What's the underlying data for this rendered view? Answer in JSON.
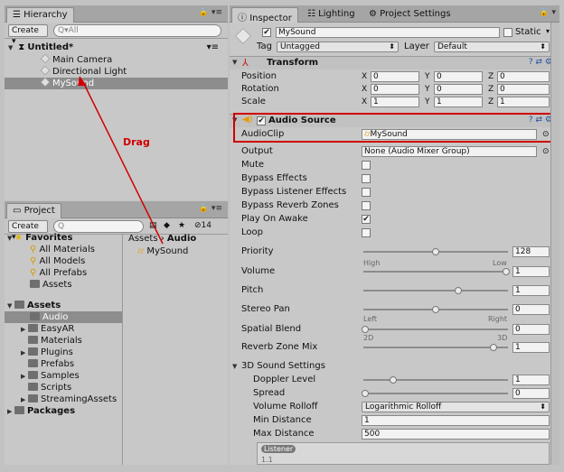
{
  "hierarchy": {
    "tab_label": "Hierarchy",
    "create_label": "Create ▾",
    "search_placeholder": "All",
    "scene_name": "Untitled*",
    "items": [
      "Main Camera",
      "Directional Light",
      "MySound"
    ]
  },
  "project": {
    "tab_label": "Project",
    "create_label": "Create ▾",
    "hidden_count": "14",
    "favorites_label": "Favorites",
    "favorites": [
      "All Materials",
      "All Models",
      "All Prefabs",
      "Assets"
    ],
    "assets_label": "Assets",
    "asset_folders": [
      "Audio",
      "EasyAR",
      "Materials",
      "Plugins",
      "Prefabs",
      "Samples",
      "Scripts",
      "StreamingAssets"
    ],
    "packages_label": "Packages",
    "breadcrumb_root": "Assets",
    "breadcrumb_sep": "›",
    "breadcrumb_current": "Audio",
    "file_name": "MySound"
  },
  "inspector": {
    "tabs": [
      "Inspector",
      "Lighting",
      "Project Settings"
    ],
    "object_name": "MySound",
    "static_label": "Static",
    "tag_label": "Tag",
    "tag_value": "Untagged",
    "layer_label": "Layer",
    "layer_value": "Default",
    "transform": {
      "title": "Transform",
      "rows": [
        {
          "label": "Position",
          "x": "0",
          "y": "0",
          "z": "0"
        },
        {
          "label": "Rotation",
          "x": "0",
          "y": "0",
          "z": "0"
        },
        {
          "label": "Scale",
          "x": "1",
          "y": "1",
          "z": "1"
        }
      ]
    },
    "audio_source": {
      "title": "Audio Source",
      "audioclip_label": "AudioClip",
      "audioclip_value": "MySound",
      "output_label": "Output",
      "output_value": "None (Audio Mixer Group)",
      "toggles": [
        {
          "label": "Mute",
          "checked": false
        },
        {
          "label": "Bypass Effects",
          "checked": false
        },
        {
          "label": "Bypass Listener Effects",
          "checked": false
        },
        {
          "label": "Bypass Reverb Zones",
          "checked": false
        },
        {
          "label": "Play On Awake",
          "checked": true
        },
        {
          "label": "Loop",
          "checked": false
        }
      ],
      "priority": {
        "label": "Priority",
        "value": "128",
        "level": 0.5,
        "low_label": "High",
        "high_label": "Low"
      },
      "volume": {
        "label": "Volume",
        "value": "1",
        "level": 1.0
      },
      "pitch": {
        "label": "Pitch",
        "value": "1",
        "level": 0.66
      },
      "stereo_pan": {
        "label": "Stereo Pan",
        "value": "0",
        "level": 0.5,
        "low_label": "Left",
        "high_label": "Right"
      },
      "spatial_blend": {
        "label": "Spatial Blend",
        "value": "0",
        "level": 0.0,
        "low_label": "2D",
        "high_label": "3D"
      },
      "reverb_zone_mix": {
        "label": "Reverb Zone Mix",
        "value": "1",
        "level": 0.91
      }
    },
    "sound_3d": {
      "title": "3D Sound Settings",
      "doppler": {
        "label": "Doppler Level",
        "value": "1",
        "level": 0.2
      },
      "spread": {
        "label": "Spread",
        "value": "0",
        "level": 0.0
      },
      "rolloff_label": "Volume Rolloff",
      "rolloff_value": "Logarithmic Rolloff",
      "min_distance_label": "Min Distance",
      "min_distance_value": "1",
      "max_distance_label": "Max Distance",
      "max_distance_value": "500",
      "graph_legend": "Listener",
      "graph_tick": "1.1"
    }
  },
  "annotation": {
    "drag_label": "Drag",
    "color": "#d00000"
  }
}
